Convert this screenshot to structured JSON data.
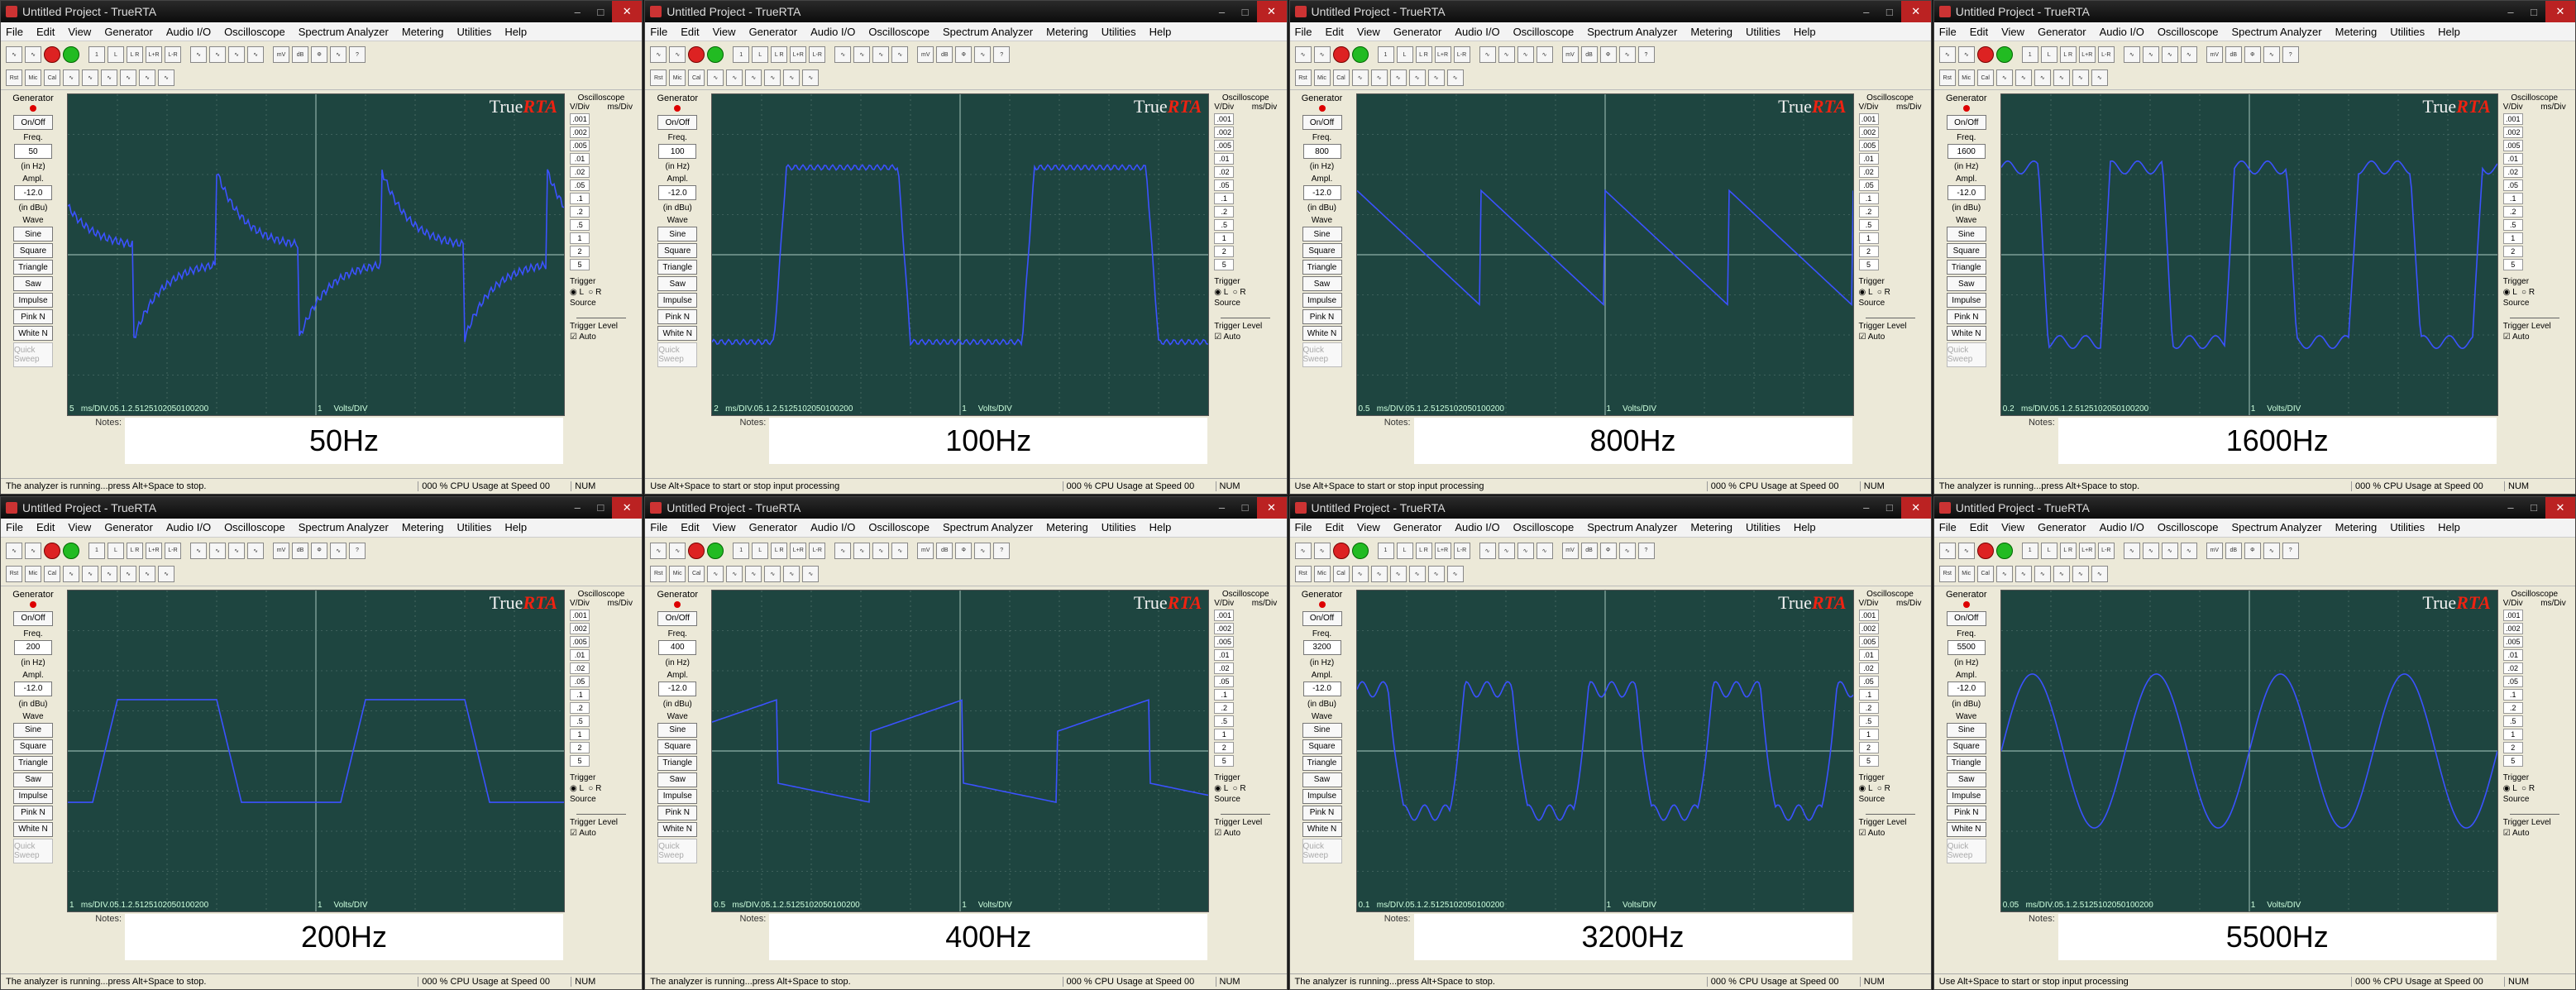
{
  "app_title": "Untitled Project - TrueRTA",
  "menus": [
    "File",
    "Edit",
    "View",
    "Generator",
    "Audio I/O",
    "Oscilloscope",
    "Spectrum Analyzer",
    "Metering",
    "Utilities",
    "Help"
  ],
  "window_controls": {
    "minimize": "–",
    "maximize": "□",
    "close": "✕"
  },
  "toolbar": {
    "row1": [
      "∿",
      "∿",
      "■",
      "●",
      "1\nIN",
      "L\nIN",
      "L R\nIN",
      "L+R\nIN",
      "L-R\nIN",
      "∿",
      "∿",
      "∿",
      "∿",
      "mV",
      "dB",
      "Ф",
      "∿",
      "?"
    ],
    "row2": [
      "Rst",
      "Mic",
      "Cal",
      "∿",
      "∿",
      "∿",
      "∿",
      "∿",
      "∿"
    ]
  },
  "generator": {
    "title": "Generator",
    "onoff_label": "On/Off",
    "freq_label": "Freq.",
    "freq_unit": "(in Hz)",
    "ampl_label": "Ampl.",
    "ampl_value": "-12.0",
    "ampl_unit": "(in dBu)",
    "wave_label": "Wave",
    "waves": [
      "Sine",
      "Square",
      "Triangle",
      "Saw",
      "Impulse",
      "Pink N",
      "White N"
    ],
    "quick_sweep": "Quick Sweep"
  },
  "oscilloscope": {
    "title": "Oscilloscope",
    "vdiv_header": "V/Div",
    "msdiv_header": "ms/Div",
    "vdiv_values": [
      ".001",
      ".002",
      ".005",
      ".01",
      ".02",
      ".05",
      ".1",
      ".2",
      ".5",
      "1",
      "2",
      "5"
    ],
    "msdiv_values": [
      ".05",
      ".1",
      ".2",
      ".5",
      "1",
      "2",
      "5",
      "10",
      "20",
      "50",
      "100",
      "200"
    ],
    "trigger_label": "Trigger",
    "trigger_l": "L",
    "trigger_r": "R",
    "source_label": "Source",
    "trigger_level_label": "Trigger Level",
    "auto_label": "Auto"
  },
  "logo": {
    "true": "True",
    "rta": "RTA"
  },
  "notes_label": "Notes:",
  "volts_div_label": "Volts/DIV",
  "ms_div_unit": "ms/DIV",
  "volts_div_value": "1",
  "status": {
    "running": "The analyzer is running...press Alt+Space to stop.",
    "stopped": "Use Alt+Space to start or stop input processing",
    "cpu": "000 % CPU Usage at Speed 00",
    "num": "NUM"
  },
  "panels": [
    {
      "freq": "50",
      "note": "50Hz",
      "msdiv": "5",
      "status_key": "running",
      "wave": "p50"
    },
    {
      "freq": "100",
      "note": "100Hz",
      "msdiv": "2",
      "status_key": "stopped",
      "wave": "p100"
    },
    {
      "freq": "800",
      "note": "800Hz",
      "msdiv": "0.5",
      "status_key": "stopped",
      "wave": "p800"
    },
    {
      "freq": "1600",
      "note": "1600Hz",
      "msdiv": "0.2",
      "status_key": "running",
      "wave": "p1600"
    },
    {
      "freq": "200",
      "note": "200Hz",
      "msdiv": "1",
      "status_key": "running",
      "wave": "p200"
    },
    {
      "freq": "400",
      "note": "400Hz",
      "msdiv": "0.5",
      "status_key": "running",
      "wave": "p400"
    },
    {
      "freq": "3200",
      "note": "3200Hz",
      "msdiv": "0.1",
      "status_key": "running",
      "wave": "p3200"
    },
    {
      "freq": "5500",
      "note": "5500Hz",
      "msdiv": "0.05",
      "status_key": "stopped",
      "wave": "p5500"
    }
  ],
  "colors": {
    "scope_bg": "#1e4540",
    "trace": "#3b52ff",
    "grid": "#5f7f78",
    "axis": "#8fb0a8"
  }
}
